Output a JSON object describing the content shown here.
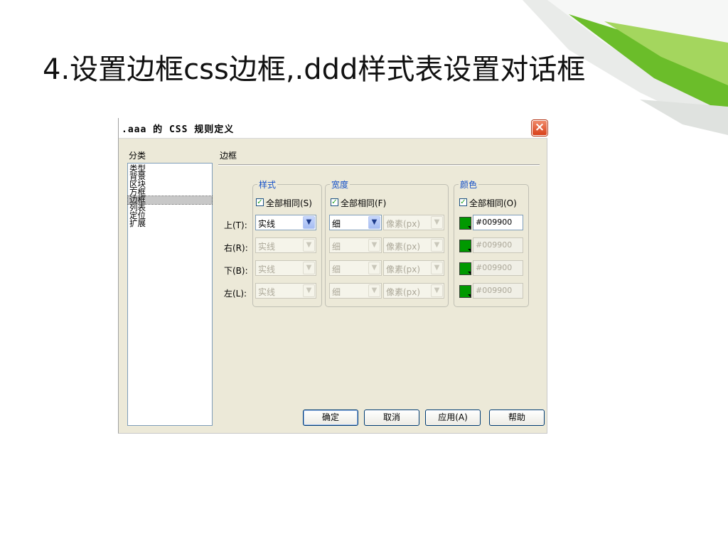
{
  "slide": {
    "title": "4.设置边框css边框,.ddd样式表设置对话框"
  },
  "dialog": {
    "title": ".aaa 的 CSS 规则定义",
    "close_label": "×",
    "category_header": "分类",
    "categories": [
      "类型",
      "背景",
      "区块",
      "方框",
      "边框",
      "列表",
      "定位",
      "扩展"
    ],
    "selected_category": "边框",
    "section_title": "边框",
    "groups": {
      "style": {
        "legend": "样式",
        "same_all": "全部相同(S)",
        "checked": true
      },
      "width": {
        "legend": "宽度",
        "same_all": "全部相同(F)",
        "checked": true
      },
      "color": {
        "legend": "颜色",
        "same_all": "全部相同(O)",
        "checked": true
      }
    },
    "sides": [
      {
        "label": "上(T):",
        "style": "实线",
        "width": "细",
        "unit": "像素(px)",
        "color": "#009900",
        "enabled": true
      },
      {
        "label": "右(R):",
        "style": "实线",
        "width": "细",
        "unit": "像素(px)",
        "color": "#009900",
        "enabled": false
      },
      {
        "label": "下(B):",
        "style": "实线",
        "width": "细",
        "unit": "像素(px)",
        "color": "#009900",
        "enabled": false
      },
      {
        "label": "左(L):",
        "style": "实线",
        "width": "细",
        "unit": "像素(px)",
        "color": "#009900",
        "enabled": false
      }
    ],
    "buttons": {
      "ok": "确定",
      "cancel": "取消",
      "apply": "应用(A)",
      "help": "帮助"
    }
  },
  "colors": {
    "swatch": "#009900",
    "accent_green": "#8cc63f",
    "legend_blue": "#1450c8"
  }
}
